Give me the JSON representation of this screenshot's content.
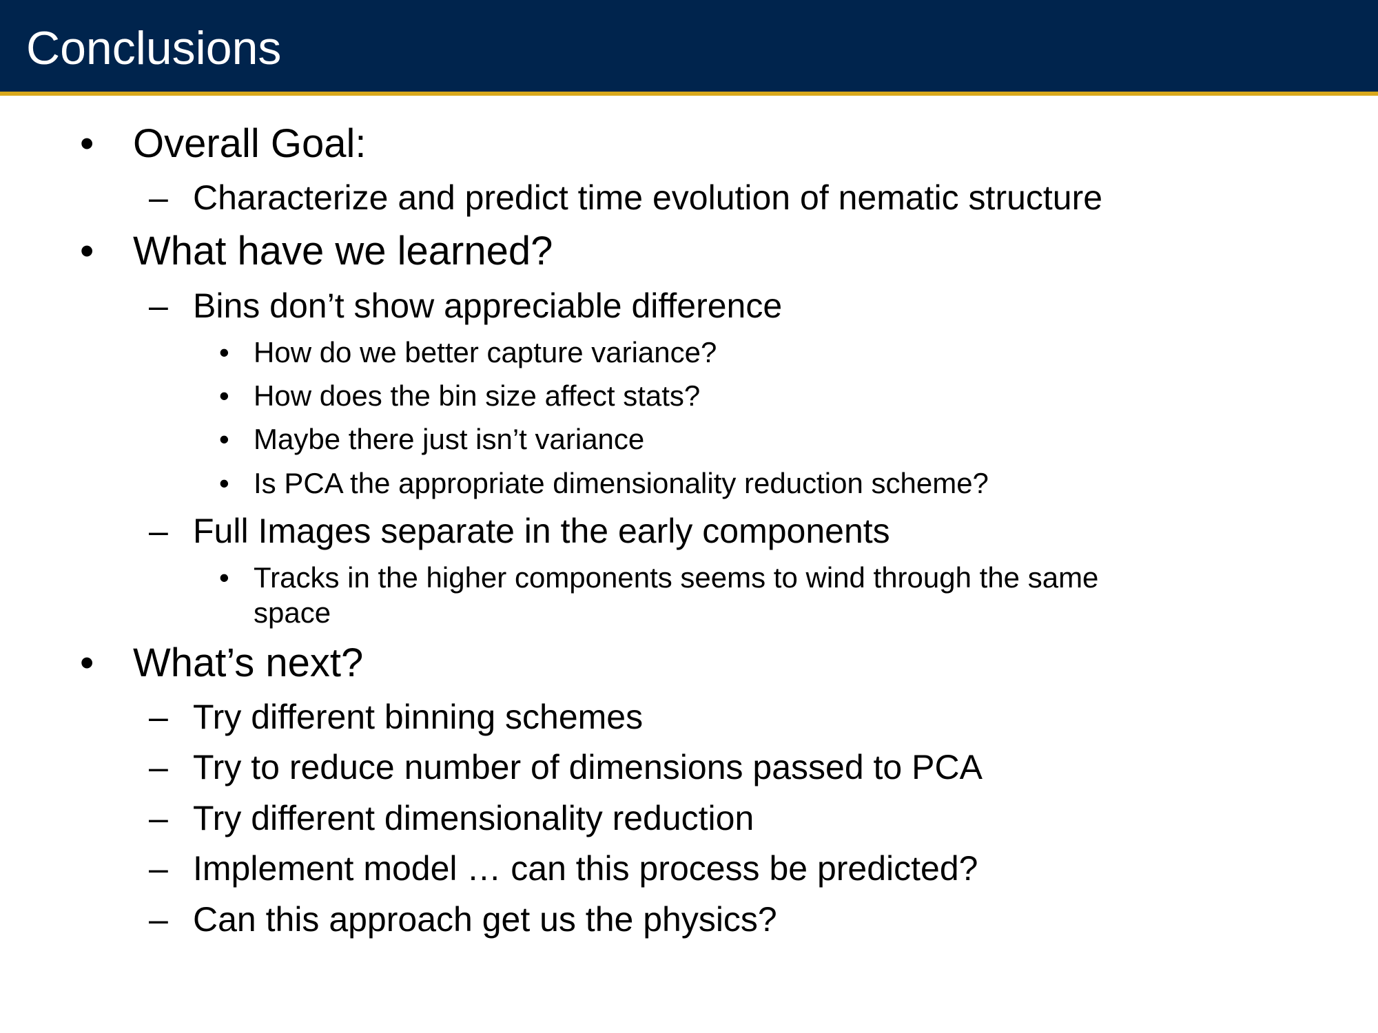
{
  "slide": {
    "title": "Conclusions",
    "bullet": "•",
    "dash": "–",
    "items": [
      {
        "level": 1,
        "text": "Overall Goal:"
      },
      {
        "level": 2,
        "text": "Characterize and predict time evolution of nematic structure"
      },
      {
        "level": 1,
        "text": "What have we learned?"
      },
      {
        "level": 2,
        "text": "Bins don’t show appreciable difference"
      },
      {
        "level": 3,
        "text": "How do we better capture variance?"
      },
      {
        "level": 3,
        "text": "How does the bin size affect stats?"
      },
      {
        "level": 3,
        "text": "Maybe there just isn’t variance"
      },
      {
        "level": 3,
        "text": "Is PCA the appropriate dimensionality reduction scheme?"
      },
      {
        "level": 2,
        "text": "Full Images separate in the early components"
      },
      {
        "level": 3,
        "text": "Tracks in the higher components seems to wind through the same"
      },
      {
        "level": 3,
        "text": "space",
        "continuation": true
      },
      {
        "level": 1,
        "text": "What’s next?"
      },
      {
        "level": 2,
        "text": "Try different binning schemes"
      },
      {
        "level": 2,
        "text": "Try to reduce number of dimensions passed to PCA"
      },
      {
        "level": 2,
        "text": "Try different dimensionality reduction"
      },
      {
        "level": 2,
        "text": "Implement model … can this process be predicted?"
      },
      {
        "level": 2,
        "text": "Can this approach get us the physics?"
      }
    ]
  },
  "colors": {
    "header_background": "#00244d",
    "header_rule": "#d9a81c",
    "title_text": "#ffffff",
    "body_text": "#000000"
  }
}
